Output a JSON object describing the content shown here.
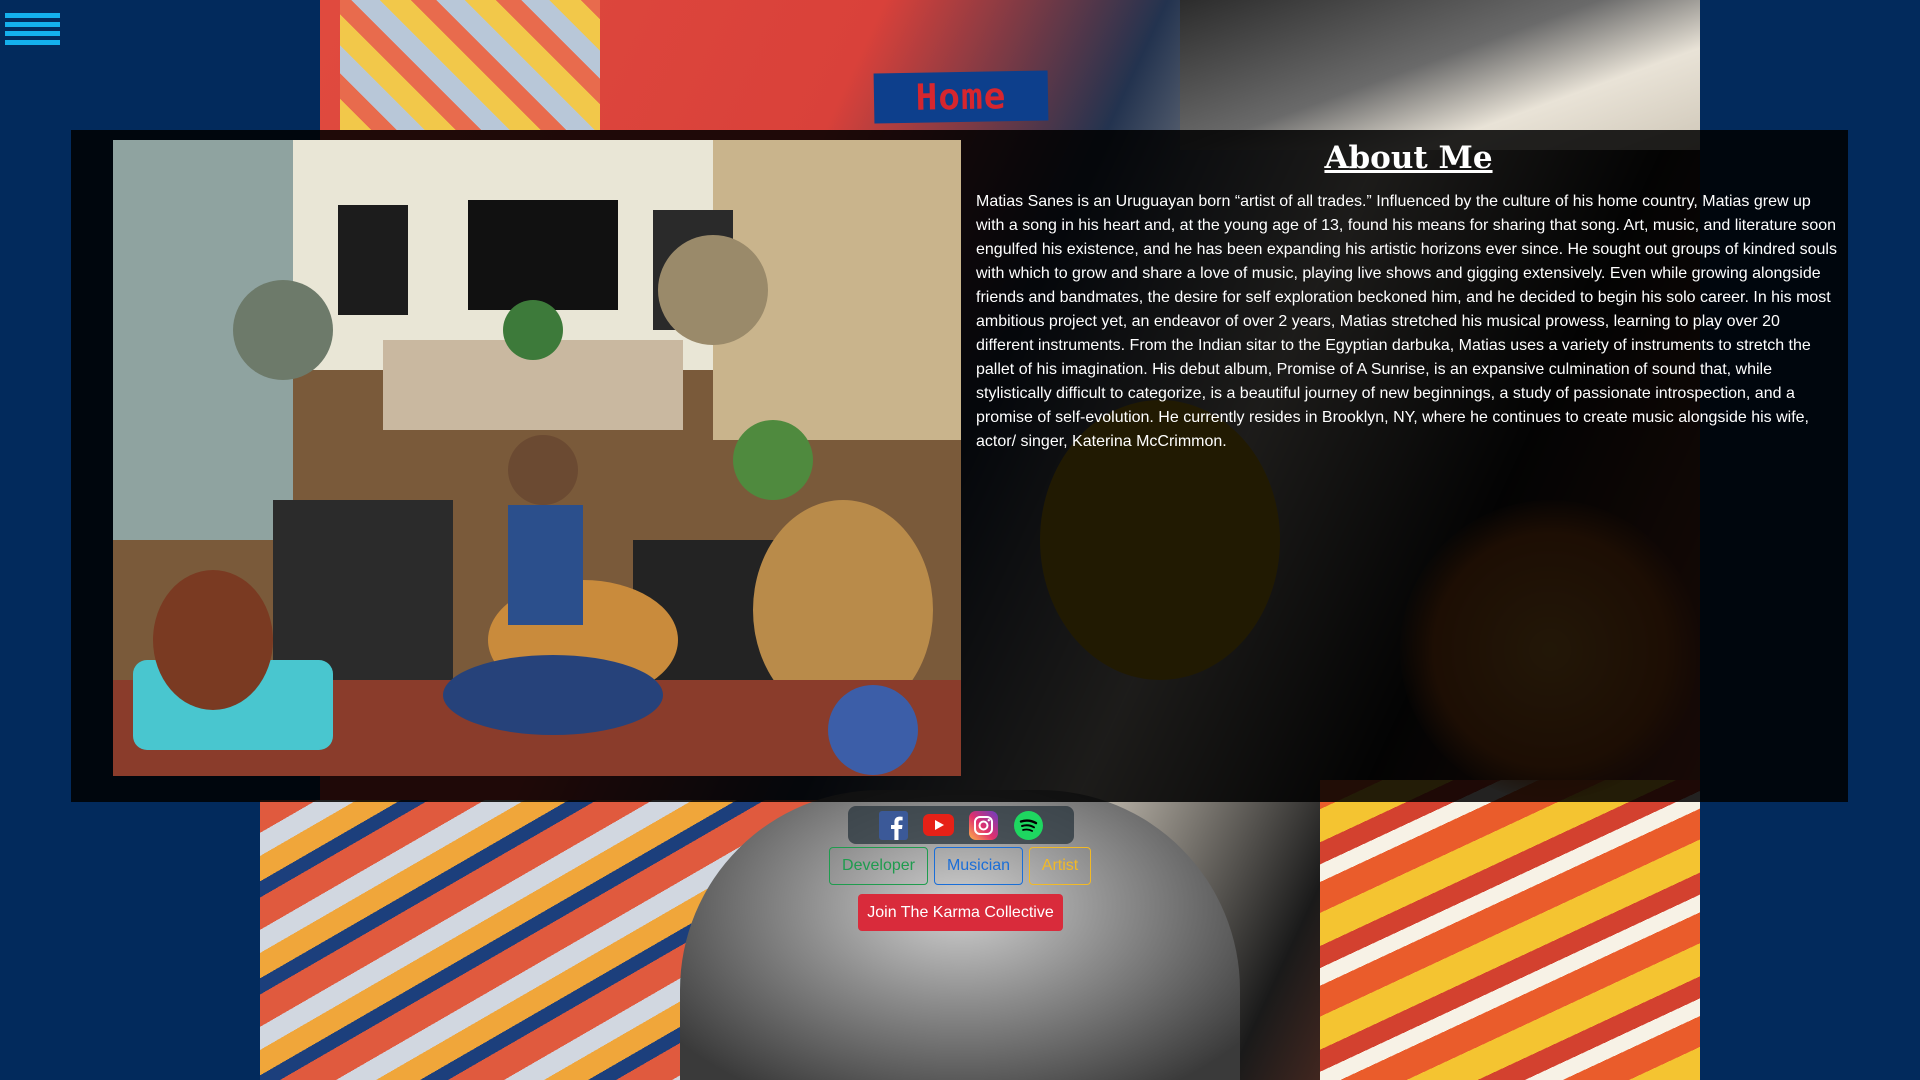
{
  "nav": {
    "menu_icon": "hamburger-menu-icon"
  },
  "page": {
    "title": "Home"
  },
  "about": {
    "heading": "About Me",
    "photo_alt": "Matias playing guitar in his music studio",
    "bio": "Matias Sanes is an Uruguayan born “artist of all trades.” Influenced by the culture of his home country, Matias grew up with a song in his heart and, at the young age of 13, found his means for sharing that song. Art, music, and literature soon engulfed his existence, and he has been expanding his artistic horizons ever since. He sought out groups of kindred souls with which to grow and share a love of music, playing live shows and gigging extensively. Even while growing alongside friends and bandmates, the desire for self exploration beckoned him, and he decided to begin his solo career. In his most ambitious project yet, an endeavor of over 2 years, Matias stretched his musical prowess, learning to play over 20 different instruments. From the Indian sitar to the Egyptian darbuka, Matias uses a variety of instruments to stretch the pallet of his imagination. His debut album, Promise of A Sunrise, is an expansive culmination of sound that, while stylistically difficult to categorize, is a beautiful journey of new beginnings, a study of passionate introspection, and a promise of self-evolution. He currently resides in Brooklyn, NY, where he continues to create music alongside his wife, actor/ singer, Katerina McCrimmon."
  },
  "social": {
    "icons": [
      "facebook-icon",
      "youtube-icon",
      "instagram-icon",
      "spotify-icon"
    ]
  },
  "roles": {
    "developer": "Developer",
    "musician": "Musician",
    "artist": "Artist"
  },
  "cta": {
    "join_label": "Join The Karma Collective"
  },
  "colors": {
    "background": "#022a5c",
    "menu": "#14b0ec",
    "home_text": "#d7262e",
    "developer": "#1f9c4e",
    "musician": "#1a6ed8",
    "artist": "#f2b926",
    "join": "#d92b3b"
  }
}
